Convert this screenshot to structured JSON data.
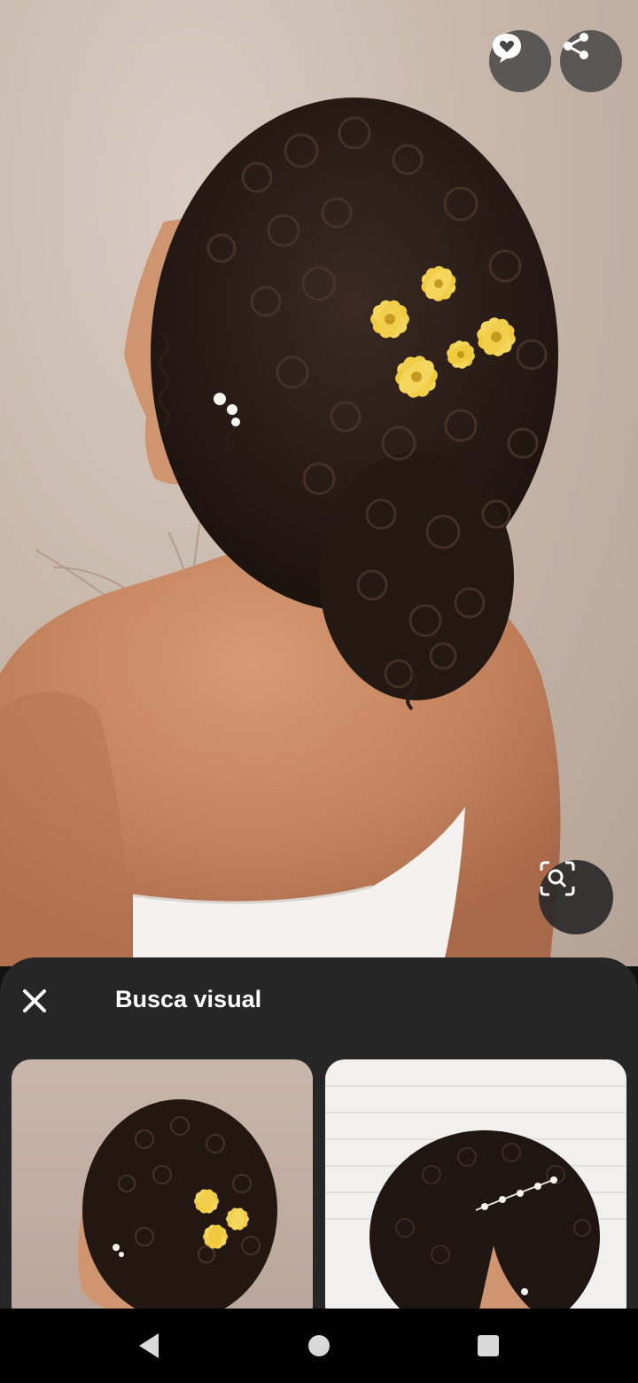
{
  "hero": {
    "image": "bride-curly-updo-yellow-flowers-photo",
    "comment_icon": "comment-heart-icon",
    "share_icon": "share-icon",
    "visual_search_icon": "visual-search-icon"
  },
  "sheet": {
    "title": "Busca visual",
    "close_icon": "close-icon",
    "results": [
      {
        "image": "curly-updo-yellow-flowers-photo"
      },
      {
        "image": "curly-updo-pearl-headpiece-photo"
      }
    ]
  },
  "navbar": {
    "back_icon": "back-triangle-icon",
    "home_icon": "home-circle-icon",
    "recents_icon": "recents-square-icon"
  },
  "colors": {
    "sheet_bg": "#262626",
    "button_bg": "#464646",
    "flower": "#f2cf4a",
    "hair": "#2a1d18",
    "skin": "#c98b66"
  }
}
